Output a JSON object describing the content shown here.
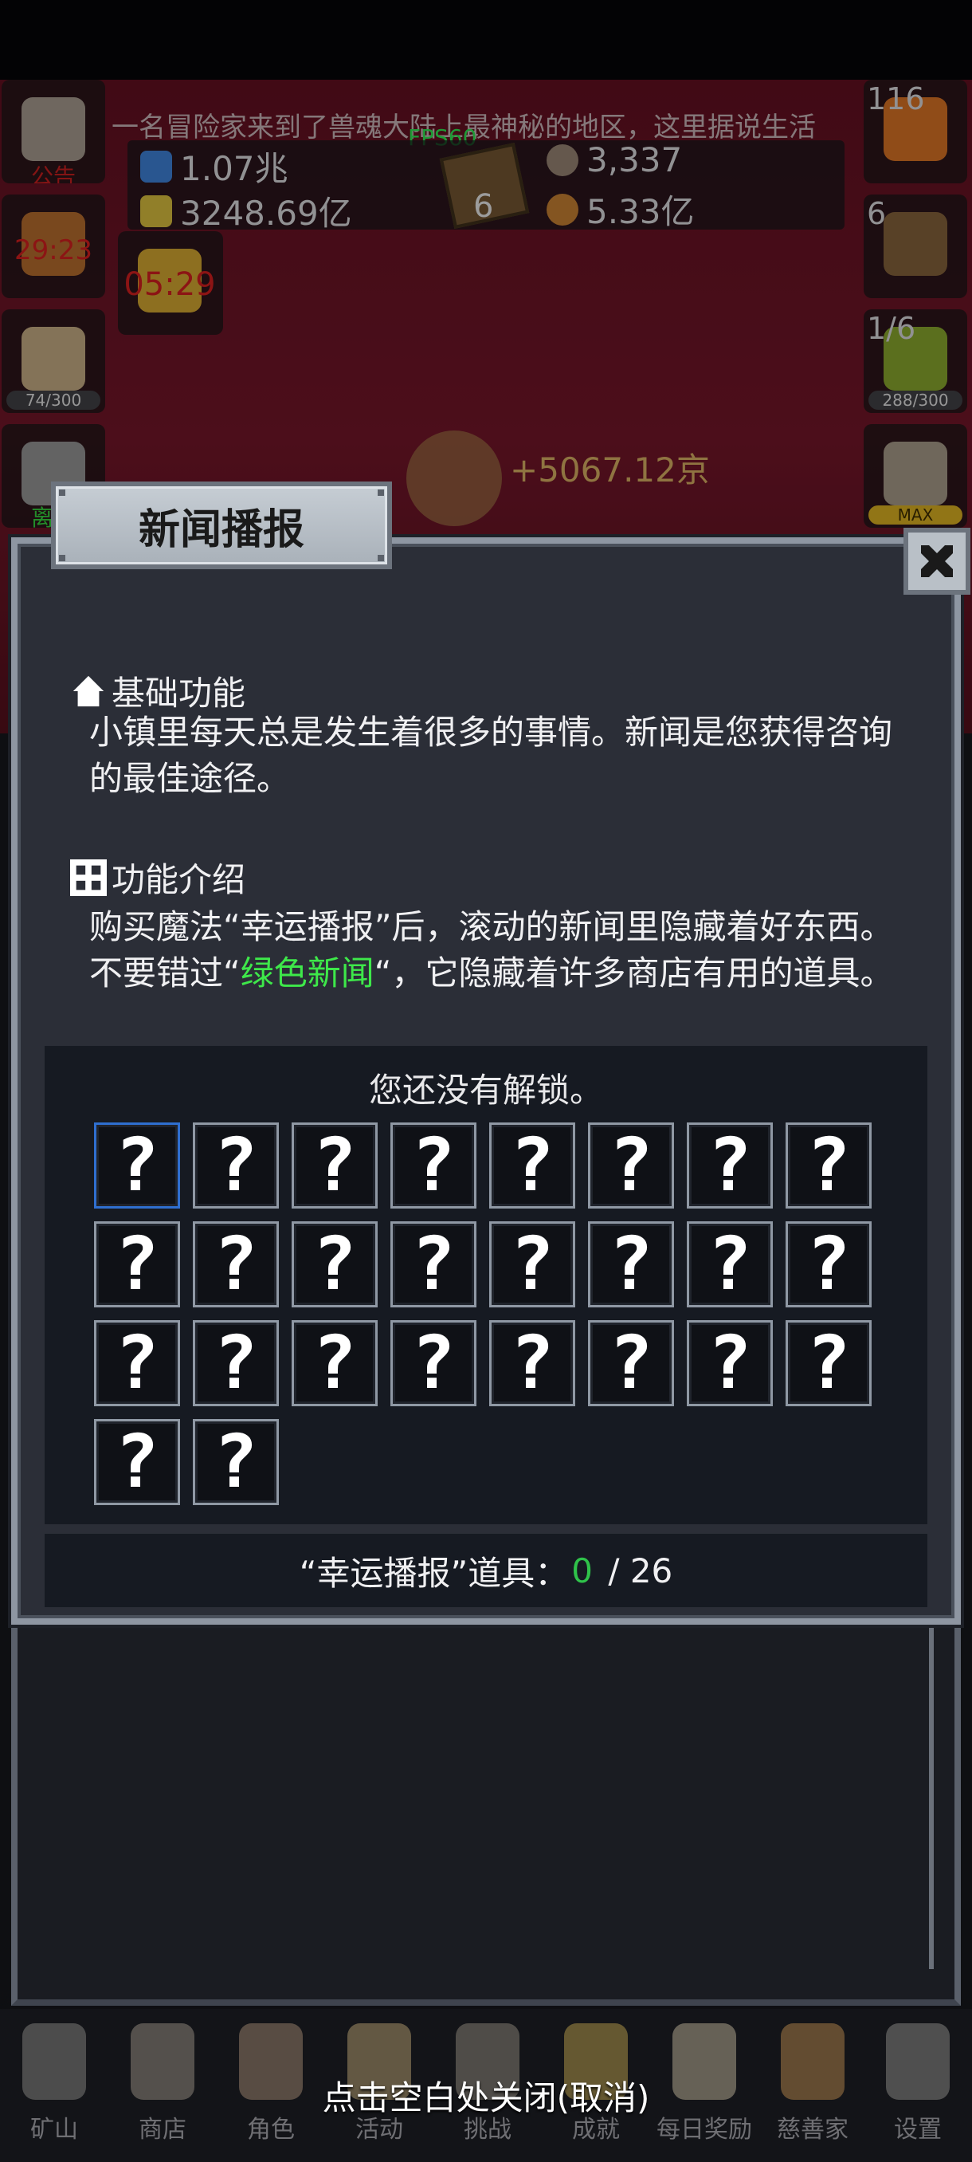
{
  "background": {
    "ticker": "一名冒险家来到了兽魂大陆上最神秘的地区，这里据说生活",
    "fps": "FPS60",
    "resources": {
      "blue_amount": "1.07兆",
      "yellow_amount": "3248.69亿",
      "stone_amount": "3,337",
      "meat_amount": "5.33亿",
      "book_count": "6"
    },
    "left_slots": {
      "notice_label": "公告",
      "timer_1": "29:23",
      "bar_1": "74/300",
      "key_label": "离线"
    },
    "center_timer": "05:29",
    "gain_text": "+5067.12京",
    "right_slots": {
      "potion_count": "116",
      "chest_count": "6",
      "slime_count": "1/6",
      "slime_bar": "288/300",
      "sword_bar": "MAX"
    },
    "nav": [
      "矿山",
      "商店",
      "角色",
      "活动",
      "挑战",
      "成就",
      "每日奖励",
      "慈善家",
      "设置"
    ]
  },
  "dialog": {
    "title": "新闻播报",
    "basic": {
      "heading": "基础功能",
      "body": "小镇里每天总是发生着很多的事情。新闻是您获得咨询的最佳途径。"
    },
    "intro": {
      "heading": "功能介绍",
      "body_part1": "购买魔法“幸运播报”后，滚动的新闻里隐藏着好东西。不要错过“",
      "body_highlight": "绿色新闻",
      "body_part2": "“，它隐藏着许多商店有用的道具。"
    },
    "locked_message": "您还没有解锁。",
    "cell_glyph": "?",
    "cells_total": 26,
    "counter": {
      "label": "“幸运播报”道具：",
      "current": "0",
      "separator": " / ",
      "total": "26"
    }
  },
  "close_hint": "点击空白处关闭(取消)",
  "colors": {
    "highlight": "#3ee84a",
    "counter_current": "#2fc24a",
    "selected_cell_border": "#2f6fd0"
  }
}
